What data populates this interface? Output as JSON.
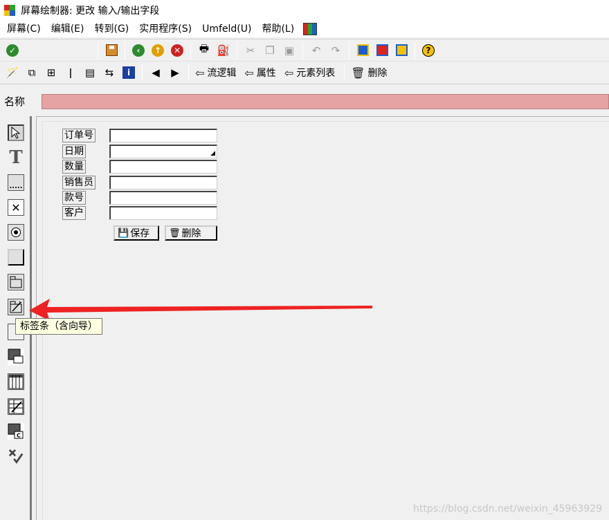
{
  "window": {
    "title": "屏幕绘制器:  更改 输入/输出字段"
  },
  "menu": [
    "屏幕(C)",
    "编辑(E)",
    "转到(G)",
    "实用程序(S)",
    "Umfeld(U)",
    "帮助(L)"
  ],
  "toolbar2": {
    "flow_logic": "流逻辑",
    "attributes": "属性",
    "element_list": "元素列表",
    "delete": "删除"
  },
  "name_row": {
    "label": "名称",
    "value": ""
  },
  "form": {
    "fields": [
      {
        "label": "订单号",
        "value": ""
      },
      {
        "label": "日期",
        "value": ""
      },
      {
        "label": "数量",
        "value": ""
      },
      {
        "label": "销售员",
        "value": ""
      },
      {
        "label": "款号",
        "value": ""
      },
      {
        "label": "客户",
        "value": ""
      }
    ],
    "save_label": "保存",
    "delete_label": "删除"
  },
  "tooltip": "标签条（含向导）",
  "watermark": "https://blog.csdn.net/weixin_45963929",
  "colors": {
    "name_input_bg": "#e6a3a3",
    "annotation_arrow": "#ee2222",
    "tooltip_bg": "#ffffe1"
  }
}
